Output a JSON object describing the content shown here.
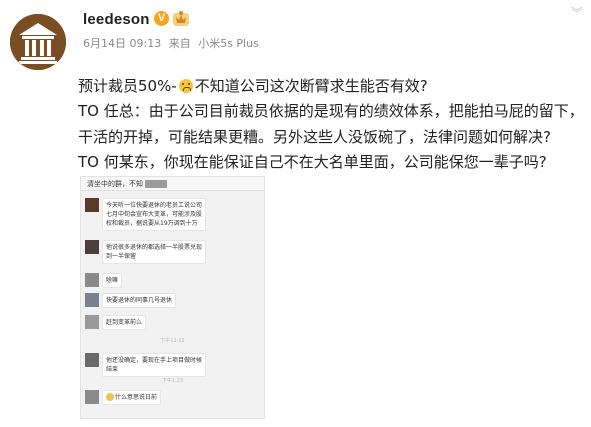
{
  "header": {
    "chevron_icon": "chevron-down-icon"
  },
  "post": {
    "avatar_icon": "courthouse-logo",
    "username": "leedeson",
    "verified_mark": "V",
    "verified_color": "#f7a41a",
    "crown_icon": "crown-badge-icon",
    "date": "6月14日 09:13",
    "source_prefix": "来自",
    "source": "小米5s Plus",
    "lines": [
      {
        "before": "预计裁员50%-",
        "after": "不知道公司这次断臂求生能否有效?"
      },
      {
        "text": "TO 任总：由于公司目前裁员依据的是现有的绩效体系，把能拍马屁的留下，"
      },
      {
        "text": "干活的开掉，可能结果更糟。另外这些人没饭碗了，法律问题如何解决?"
      },
      {
        "text": "TO 何某东，你现在能保证自己不在大名单里面，公司能保您一辈子吗?"
      }
    ]
  },
  "screenshot": {
    "header_title": "清坐中的群，不知",
    "messages": [
      {
        "lines": [
          "今天听一位快要退休的老员工说公司",
          "七月中旬会宣布大变革，可能涉及股",
          "权和裁员，据说要从19万调到十万"
        ]
      },
      {
        "lines": [
          "他说很多退休的都选择一半股票兑现",
          "到一半保留"
        ]
      },
      {
        "lines": [
          "啥嘛"
        ]
      },
      {
        "lines": [
          "快要退休的同事几号退休"
        ]
      },
      {
        "lines": [
          "赶到变革前么"
        ]
      },
      {
        "lines": [
          "他还没确定，要现在手上项目做时候",
          "结束"
        ]
      },
      {
        "lines": [
          "什么意思说日前"
        ],
        "emoji": true
      }
    ],
    "timestamps": [
      "下午11:11",
      "下午1:23"
    ]
  }
}
